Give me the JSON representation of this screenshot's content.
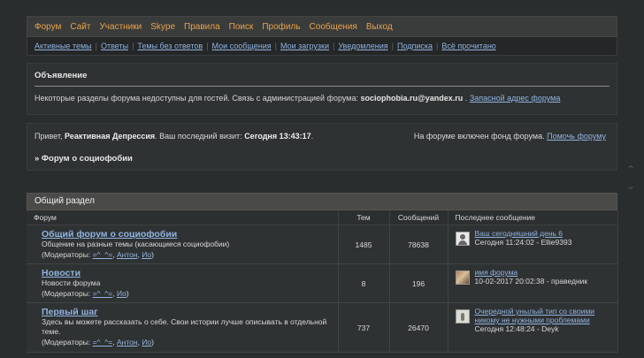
{
  "nav": {
    "main": [
      "Форум",
      "Сайт",
      "Участники",
      "Skype",
      "Правила",
      "Поиск",
      "Профиль",
      "Сообщения",
      "Выход"
    ],
    "sub": [
      "Активные темы",
      "Ответы",
      "Темы без ответов",
      "Мои сообщения",
      "Мои загрузки",
      "Уведомления",
      "Подписка",
      "Всё прочитано"
    ]
  },
  "announce": {
    "title": "Объявление",
    "text": "Некоторые разделы форума недоступны для гостей. Связь с администрацией форума:",
    "email": "sociophobia.ru@yandex.ru",
    "dot": ".",
    "link": "Запасной адрес форума"
  },
  "welcome": {
    "greeting": "Привет,",
    "user": "Реактивная Депрессия",
    "visit_label": ". Ваш последний визит:",
    "visit_time": "Сегодня 13:43:17",
    "end": ".",
    "fund": "На форуме включен фонд форума.",
    "help": "Помочь форуму",
    "crumb": "» Форум о социофобии"
  },
  "section": {
    "title": "Общий раздел",
    "headers": {
      "forum": "Форум",
      "topics": "Тем",
      "posts": "Сообщений",
      "last": "Последнее сообщение"
    },
    "rows": [
      {
        "title": "Общий форум о социофобии",
        "desc": "Общение на разные темы (касающиеся социофобии)",
        "mods_label": "(Модераторы: ",
        "mods": [
          "=^_^=",
          "Антон",
          "Ио"
        ],
        "topics": "1485",
        "posts": "78638",
        "last_title": "Ваш сегодняшний день 6",
        "last_meta": "Сегодня 11:24:02 - Ellie9393"
      },
      {
        "title": "Новости",
        "desc": "Новости форума",
        "mods_label": "(Модераторы: ",
        "mods": [
          "=^_^=",
          "Ио"
        ],
        "topics": "8",
        "posts": "196",
        "last_title": "имя форума",
        "last_meta": "10-02-2017 20:02:38 - праведник"
      },
      {
        "title": "Первый шаг",
        "desc": "Здесь вы можете рассказать о себе. Свои истории лучше описывать в отдельной теме.",
        "mods_label": "(Модераторы: ",
        "mods": [
          "=^_^=",
          "Антон",
          "Ио"
        ],
        "topics": "737",
        "posts": "26470",
        "last_title": "Очередной унылый тип со своими никому не нужными проблемами",
        "last_meta": "Сегодня 12:48:24 - Deyk"
      }
    ]
  }
}
